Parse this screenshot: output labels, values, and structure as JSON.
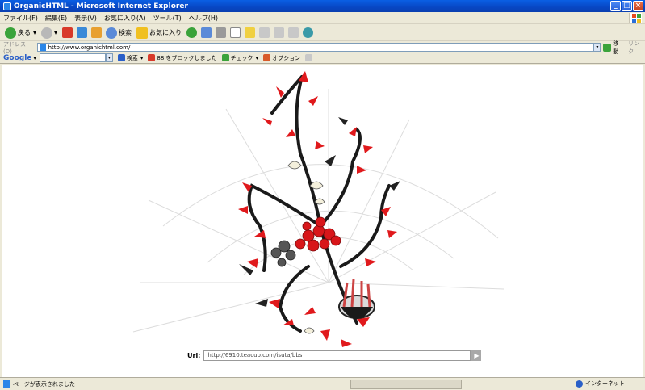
{
  "window": {
    "title": "OrganicHTML - Microsoft Internet Explorer",
    "controls": {
      "minimize": "_",
      "maximize": "□",
      "close": "×"
    }
  },
  "menu": [
    "ファイル(F)",
    "編集(E)",
    "表示(V)",
    "お気に入り(A)",
    "ツール(T)",
    "ヘルプ(H)"
  ],
  "toolbar": {
    "back_label": "戻る",
    "search_label": "検索",
    "favorites_label": "お気に入り"
  },
  "address": {
    "label": "アドレス(D)",
    "url": "http://www.organichtml.com/",
    "go_label": "移動",
    "links_label": "リンク"
  },
  "google_bar": {
    "logo": "Google",
    "search_label": "検索",
    "blocked_label": "88 をブロックしました",
    "check_label": "チェック",
    "options_label": "オプション"
  },
  "page": {
    "url_label": "Url:",
    "url_value": "http://6910.teacup.com/isuta/bbs",
    "url_go": "▶"
  },
  "status": {
    "text": "ページが表示されました",
    "zone": "インターネット"
  },
  "colors": {
    "title_bar": "#0847c4",
    "chrome": "#ece9d8",
    "petal_red": "#e0191c",
    "stem_dark": "#1a1a1a"
  }
}
